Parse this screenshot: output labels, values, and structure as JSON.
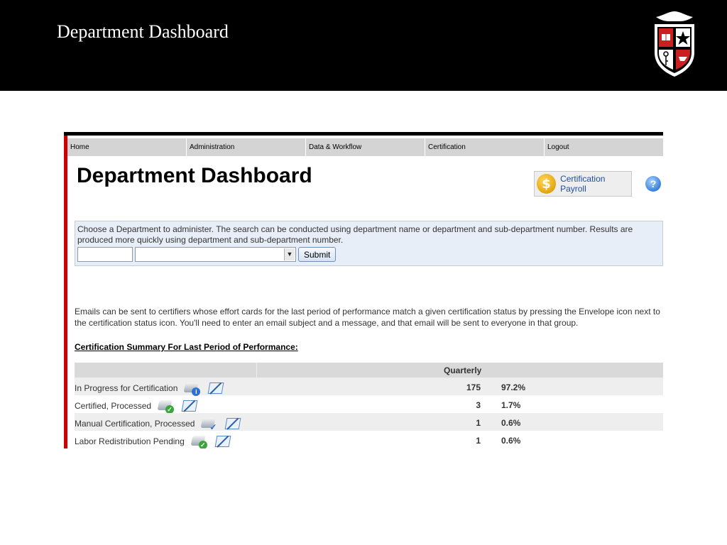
{
  "slide": {
    "title": "Department Dashboard"
  },
  "nav": {
    "items": [
      {
        "label": "Home"
      },
      {
        "label": "Administration"
      },
      {
        "label": "Data & Workflow"
      },
      {
        "label": "Certification"
      },
      {
        "label": "Logout"
      }
    ]
  },
  "page": {
    "title": "Department Dashboard",
    "cert_payroll_label": "Certification Payroll",
    "help_label": "?"
  },
  "search": {
    "instructions": "Choose a Department to administer. The search can be conducted using department name or department and sub-department number. Results are produced more quickly using department and sub-department number.",
    "dept_input_value": "",
    "dept_select_value": "",
    "submit_label": "Submit"
  },
  "email_text": "Emails can be sent to certifiers whose effort cards for the last period of performance match a given certification status by pressing the Envelope icon next to the certification status icon. You'll need to enter an email subject and a message, and that email will be sent to everyone in that group.",
  "summary": {
    "heading": "Certification Summary For Last Period of Performance:",
    "column_header": "Quarterly",
    "rows": [
      {
        "label": "In Progress for Certification",
        "count": "175",
        "percent": "97.2%",
        "status_icon": "info-status-icon"
      },
      {
        "label": "Certified, Processed",
        "count": "3",
        "percent": "1.7%",
        "status_icon": "ok-status-icon"
      },
      {
        "label": "Manual Certification, Processed",
        "count": "1",
        "percent": "0.6%",
        "status_icon": "check-status-icon"
      },
      {
        "label": "Labor Redistribution Pending",
        "count": "1",
        "percent": "0.6%",
        "status_icon": "ok-status-icon"
      }
    ]
  },
  "colors": {
    "slide_header_bg": "#000000",
    "left_accent": "#cc0000",
    "nav_bg": "#d4d4d4",
    "search_bg": "#e8eef7",
    "link_blue": "#1f4e98"
  }
}
